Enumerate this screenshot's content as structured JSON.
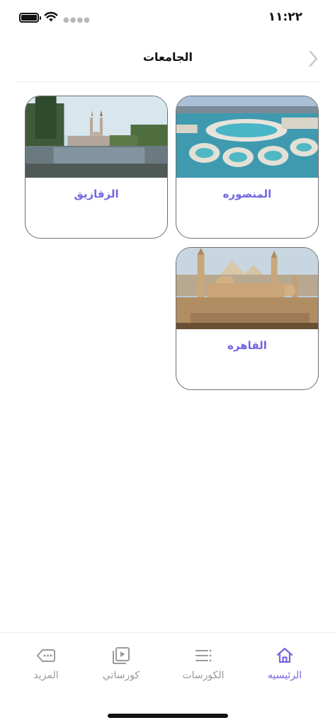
{
  "status_bar": {
    "time": "١١:٢٢"
  },
  "header": {
    "title": "الجامعات"
  },
  "universities": [
    {
      "name": "المنصوره"
    },
    {
      "name": "الزقازيق"
    },
    {
      "name": "القاهره"
    }
  ],
  "tab_bar": {
    "tabs": [
      {
        "label": "الرئيسيه",
        "icon": "home-icon",
        "active": true
      },
      {
        "label": "الكورسات",
        "icon": "list-icon",
        "active": false
      },
      {
        "label": "كورساتي",
        "icon": "video-library-icon",
        "active": false
      },
      {
        "label": "المزيد",
        "icon": "more-tag-icon",
        "active": false
      }
    ]
  },
  "colors": {
    "accent": "#7466e0",
    "inactive": "#9a9a9a"
  }
}
